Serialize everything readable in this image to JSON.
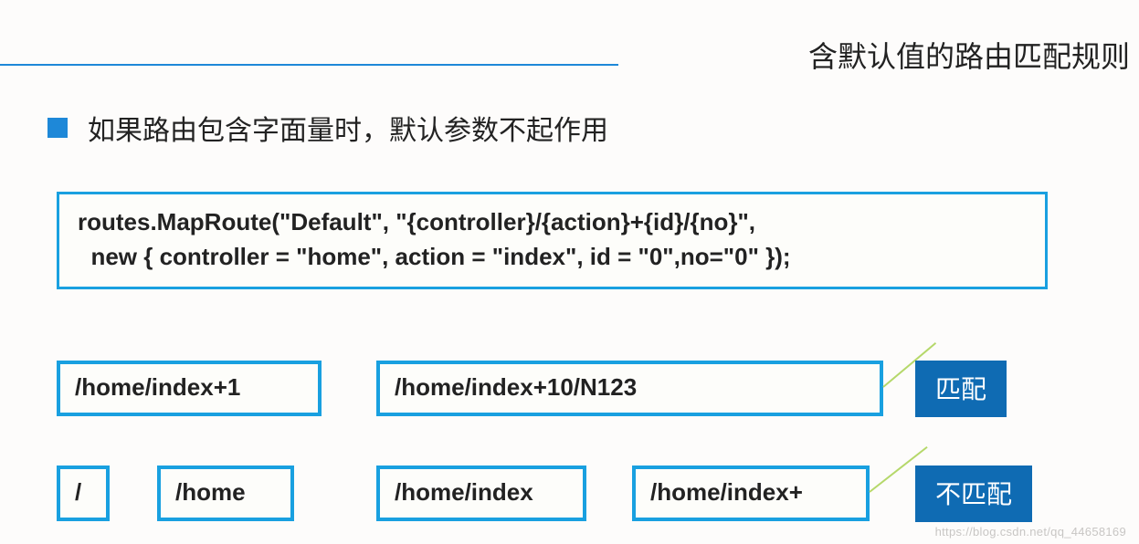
{
  "header": {
    "title": "含默认值的路由匹配规则"
  },
  "bullet": {
    "text": "如果路由包含字面量时，默认参数不起作用"
  },
  "code": {
    "line1": "routes.MapRoute(\"Default\", \"{controller}/{action}+{id}/{no}\",",
    "line2": "  new { controller = \"home\", action = \"index\", id = \"0\",no=\"0\" });"
  },
  "matches": {
    "box1": "/home/index+1",
    "box2": "/home/index+10/N123",
    "label": "匹配"
  },
  "nomatches": {
    "box1": "/",
    "box2": "/home",
    "box3": "/home/index",
    "box4": "/home/index+",
    "label": "不匹配"
  },
  "watermark": "https://blog.csdn.net/qq_44658169"
}
